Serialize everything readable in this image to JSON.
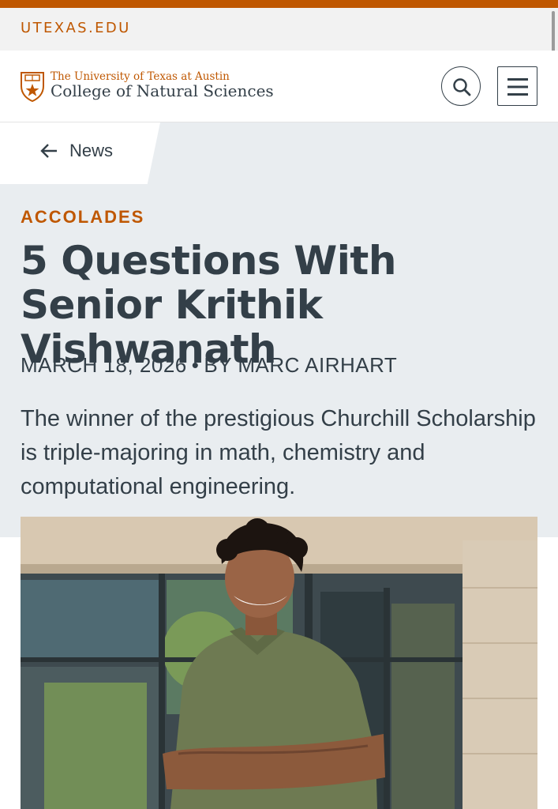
{
  "utility_bar": {
    "link_text": "UTEXAS.EDU"
  },
  "header": {
    "logo_line1": "The University of Texas at Austin",
    "logo_line2": "College of Natural Sciences",
    "search_icon": "search-icon",
    "menu_icon": "hamburger-menu-icon"
  },
  "nav": {
    "back_label": "News",
    "back_icon": "arrow-left-icon"
  },
  "article": {
    "category": "ACCOLADES",
    "title": "5 Questions With Senior Krithik Vishwanath",
    "date": "MARCH 18, 2026",
    "separator": "•",
    "author": "BY MARC AIRHART",
    "deck": "The winner of the prestigious Churchill Scholarship is triple-majoring in math, chemistry and computational engineering."
  },
  "colors": {
    "brand_orange": "#bf5700",
    "text_dark": "#333f48",
    "hero_bg": "#e9edf0"
  }
}
